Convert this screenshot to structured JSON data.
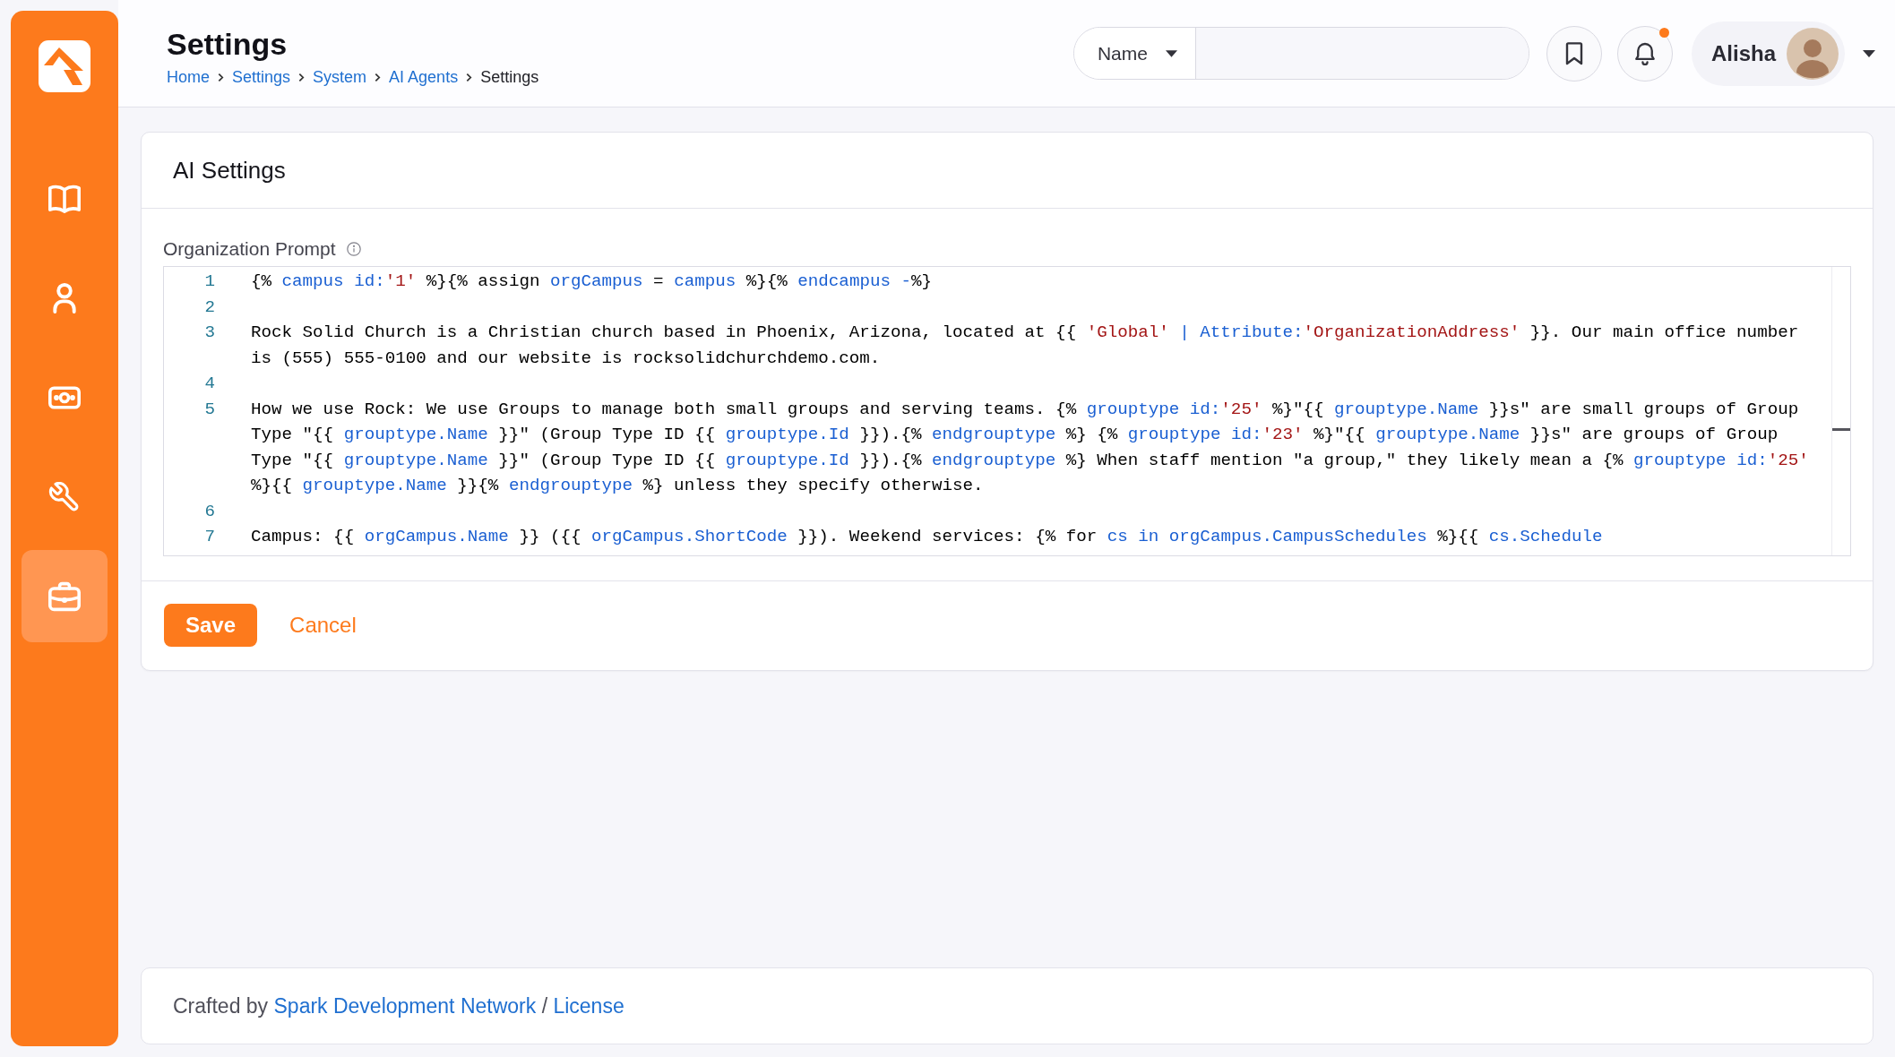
{
  "sidebar": {
    "items": [
      {
        "kind": "book",
        "selected": false
      },
      {
        "kind": "person",
        "selected": false
      },
      {
        "kind": "money",
        "selected": false
      },
      {
        "kind": "wrench",
        "selected": false
      },
      {
        "kind": "briefcase",
        "selected": true
      }
    ]
  },
  "header": {
    "title": "Settings",
    "breadcrumb": [
      {
        "label": "Home",
        "current": false
      },
      {
        "label": "Settings",
        "current": false
      },
      {
        "label": "System",
        "current": false
      },
      {
        "label": "AI Agents",
        "current": false
      },
      {
        "label": "Settings",
        "current": true
      }
    ]
  },
  "search": {
    "filter": "Name"
  },
  "notifications": {
    "unread": true
  },
  "user": {
    "name": "Alisha"
  },
  "card": {
    "title": "AI Settings",
    "field": {
      "label": "Organization Prompt",
      "lines": [
        {
          "number": "1",
          "segments": [
            {
              "kind": "plain",
              "text": "{% "
            },
            {
              "kind": "keyword",
              "text": "campus id:"
            },
            {
              "kind": "string",
              "text": "'1'"
            },
            {
              "kind": "plain",
              "text": " %}{% assign "
            },
            {
              "kind": "keyword",
              "text": "orgCampus"
            },
            {
              "kind": "plain",
              "text": " = "
            },
            {
              "kind": "keyword",
              "text": "campus"
            },
            {
              "kind": "plain",
              "text": " %}{% "
            },
            {
              "kind": "keyword",
              "text": "endcampus -"
            },
            {
              "kind": "plain",
              "text": "%}"
            }
          ]
        },
        {
          "number": "2"
        },
        {
          "number": "3",
          "segments": [
            {
              "kind": "plain",
              "text": "Rock Solid Church is a Christian church based in Phoenix, Arizona, located at {{ "
            },
            {
              "kind": "string",
              "text": "'Global'"
            },
            {
              "kind": "keyword",
              "text": " | Attribute:"
            },
            {
              "kind": "string",
              "text": "'OrganizationAddress'"
            },
            {
              "kind": "plain",
              "text": " }}. Our main office number is (555) 555-0100 and our website is rocksolidchurchdemo.com."
            }
          ]
        },
        {
          "number": "4"
        },
        {
          "number": "5",
          "segments": [
            {
              "kind": "plain",
              "text": "How we use Rock: We use Groups to manage both small groups and serving teams. {% "
            },
            {
              "kind": "keyword",
              "text": "grouptype id:"
            },
            {
              "kind": "string",
              "text": "'25'"
            },
            {
              "kind": "plain",
              "text": " %}\"{{ "
            },
            {
              "kind": "keyword",
              "text": "grouptype.Name"
            },
            {
              "kind": "plain",
              "text": " }}s\" are small groups of Group Type \"{{ "
            },
            {
              "kind": "keyword",
              "text": "grouptype.Name"
            },
            {
              "kind": "plain",
              "text": " }}\" (Group Type ID {{ "
            },
            {
              "kind": "keyword",
              "text": "grouptype.Id"
            },
            {
              "kind": "plain",
              "text": " }}).{% "
            },
            {
              "kind": "keyword",
              "text": "endgrouptype"
            },
            {
              "kind": "plain",
              "text": " %} {% "
            },
            {
              "kind": "keyword",
              "text": "grouptype id:"
            },
            {
              "kind": "string",
              "text": "'23'"
            },
            {
              "kind": "plain",
              "text": " %}\"{{ "
            },
            {
              "kind": "keyword",
              "text": "grouptype.Name"
            },
            {
              "kind": "plain",
              "text": " }}s\" are groups of Group Type \"{{ "
            },
            {
              "kind": "keyword",
              "text": "grouptype.Name"
            },
            {
              "kind": "plain",
              "text": " }}\" (Group Type ID {{ "
            },
            {
              "kind": "keyword",
              "text": "grouptype.Id"
            },
            {
              "kind": "plain",
              "text": " }}).{% "
            },
            {
              "kind": "keyword",
              "text": "endgrouptype"
            },
            {
              "kind": "plain",
              "text": " %} When staff mention \"a group,\" they likely mean a {% "
            },
            {
              "kind": "keyword",
              "text": "grouptype id:"
            },
            {
              "kind": "string",
              "text": "'25'"
            },
            {
              "kind": "plain",
              "text": " %}{{ "
            },
            {
              "kind": "keyword",
              "text": "grouptype.Name"
            },
            {
              "kind": "plain",
              "text": " }}{% "
            },
            {
              "kind": "keyword",
              "text": "endgrouptype"
            },
            {
              "kind": "plain",
              "text": " %} unless they specify otherwise."
            }
          ]
        },
        {
          "number": "6"
        },
        {
          "number": "7",
          "segments": [
            {
              "kind": "plain",
              "text": "Campus: {{ "
            },
            {
              "kind": "keyword",
              "text": "orgCampus.Name"
            },
            {
              "kind": "plain",
              "text": " }} ({{ "
            },
            {
              "kind": "keyword",
              "text": "orgCampus.ShortCode"
            },
            {
              "kind": "plain",
              "text": " }}). Weekend services: {% for "
            },
            {
              "kind": "keyword",
              "text": "cs in orgCampus.CampusSchedules"
            },
            {
              "kind": "plain",
              "text": " %}{{ "
            },
            {
              "kind": "keyword",
              "text": "cs.Schedule"
            }
          ]
        }
      ]
    },
    "buttons": [
      {
        "label": "Save",
        "kind": "primary"
      },
      {
        "label": "Cancel",
        "kind": "link"
      }
    ]
  },
  "footer": {
    "parts": [
      {
        "kind": "text",
        "text": "Crafted by"
      },
      {
        "kind": "link",
        "text": "Spark Development Network"
      },
      {
        "kind": "text",
        "text": "/"
      },
      {
        "kind": "link",
        "text": "License"
      }
    ]
  }
}
